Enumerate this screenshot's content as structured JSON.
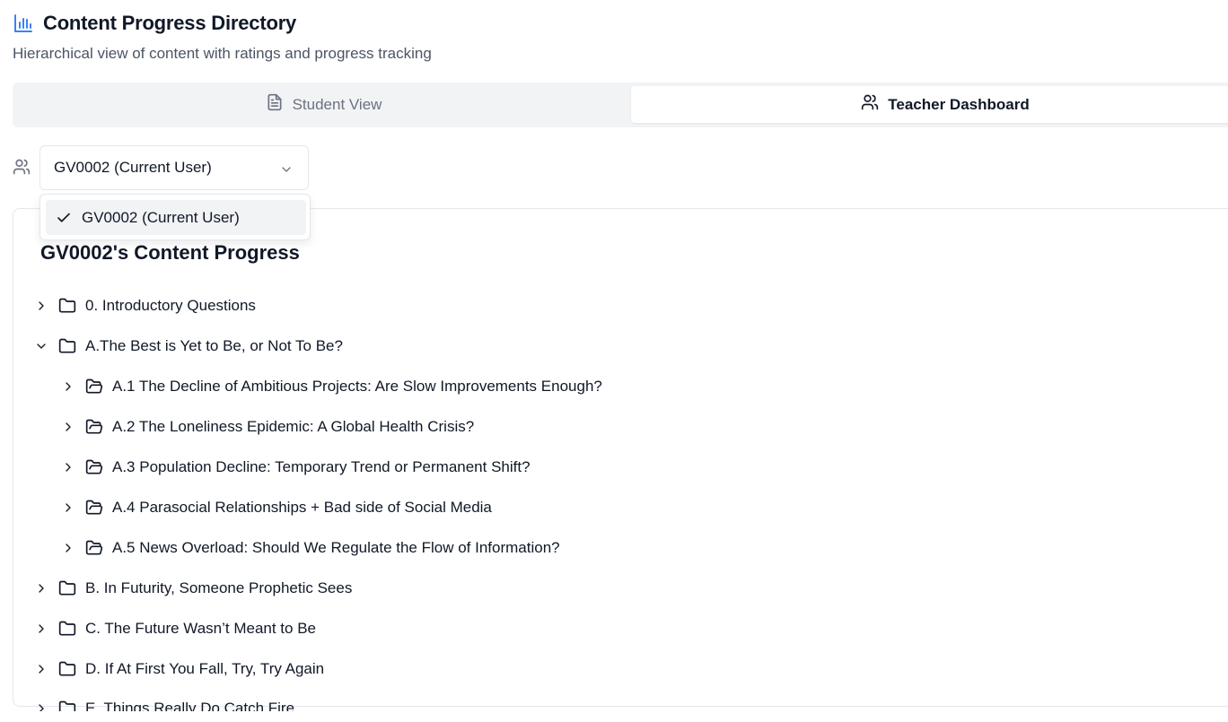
{
  "header": {
    "title": "Content Progress Directory",
    "subtitle": "Hierarchical view of content with ratings and progress tracking"
  },
  "tabs": [
    {
      "label": "Student View",
      "icon": "file-text-icon",
      "active": false
    },
    {
      "label": "Teacher Dashboard",
      "icon": "users-icon",
      "active": true
    }
  ],
  "user_select": {
    "value": "GV0002 (Current User)",
    "options": [
      {
        "label": "GV0002 (Current User)",
        "selected": true
      }
    ]
  },
  "progress": {
    "title": "GV0002's Content Progress",
    "items": [
      {
        "label": "0. Introductory Questions",
        "expanded": false,
        "level": 0
      },
      {
        "label": "A.The Best is Yet to Be, or Not To Be?",
        "expanded": true,
        "level": 0
      },
      {
        "label": "A.1 The Decline of Ambitious Projects: Are Slow Improvements Enough?",
        "expanded": false,
        "level": 1
      },
      {
        "label": "A.2 The Loneliness Epidemic: A Global Health Crisis?",
        "expanded": false,
        "level": 1
      },
      {
        "label": "A.3 Population Decline: Temporary Trend or Permanent Shift?",
        "expanded": false,
        "level": 1
      },
      {
        "label": "A.4 Parasocial Relationships + Bad side of Social Media",
        "expanded": false,
        "level": 1
      },
      {
        "label": "A.5 News Overload: Should We Regulate the Flow of Information?",
        "expanded": false,
        "level": 1
      },
      {
        "label": "B. In Futurity, Someone Prophetic Sees",
        "expanded": false,
        "level": 0
      },
      {
        "label": "C. The Future Wasn’t Meant to Be",
        "expanded": false,
        "level": 0
      },
      {
        "label": "D. If At First You Fall, Try, Try Again",
        "expanded": false,
        "level": 0
      },
      {
        "label": "E. Things Really Do Catch Fire",
        "expanded": false,
        "level": 0
      }
    ]
  },
  "colors": {
    "accent": "#3b82f6",
    "text": "#111827",
    "muted": "#4b5563"
  }
}
